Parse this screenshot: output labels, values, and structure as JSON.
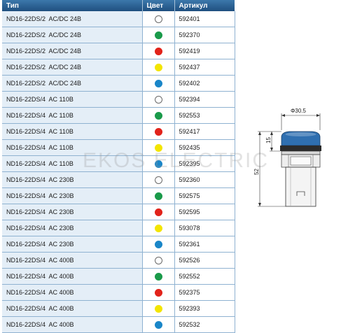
{
  "table": {
    "headers": [
      "Тип",
      "Цвет",
      "Артикул"
    ],
    "rows": [
      {
        "type": "ND16-22DS/2  AC/DC 24B",
        "color": "white",
        "article": "592401"
      },
      {
        "type": "ND16-22DS/2  AC/DC 24B",
        "color": "green",
        "article": "592370"
      },
      {
        "type": "ND16-22DS/2  AC/DC 24B",
        "color": "red",
        "article": "592419"
      },
      {
        "type": "ND16-22DS/2  AC/DC 24B",
        "color": "yellow",
        "article": "592437"
      },
      {
        "type": "ND16-22DS/2  AC/DC 24B",
        "color": "blue",
        "article": "592402"
      },
      {
        "type": "ND16-22DS/4  AC 110B",
        "color": "white",
        "article": "592394"
      },
      {
        "type": "ND16-22DS/4  AC 110B",
        "color": "green",
        "article": "592553"
      },
      {
        "type": "ND16-22DS/4  AC 110B",
        "color": "red",
        "article": "592417"
      },
      {
        "type": "ND16-22DS/4  AC 110B",
        "color": "yellow",
        "article": "592435"
      },
      {
        "type": "ND16-22DS/4  AC 110B",
        "color": "blue",
        "article": "592395"
      },
      {
        "type": "ND16-22DS/4  AC 230B",
        "color": "white",
        "article": "592360"
      },
      {
        "type": "ND16-22DS/4  AC 230B",
        "color": "green",
        "article": "592575"
      },
      {
        "type": "ND16-22DS/4  AC 230B",
        "color": "red",
        "article": "592595"
      },
      {
        "type": "ND16-22DS/4  AC 230B",
        "color": "yellow",
        "article": "593078"
      },
      {
        "type": "ND16-22DS/4  AC 230B",
        "color": "blue",
        "article": "592361"
      },
      {
        "type": "ND16-22DS/4  AC 400B",
        "color": "white",
        "article": "592526"
      },
      {
        "type": "ND16-22DS/4  AC 400B",
        "color": "green",
        "article": "592552"
      },
      {
        "type": "ND16-22DS/4  AC 400B",
        "color": "red",
        "article": "592375"
      },
      {
        "type": "ND16-22DS/4  AC 400B",
        "color": "yellow",
        "article": "592393"
      },
      {
        "type": "ND16-22DS/4  AC 400B",
        "color": "blue",
        "article": "592532"
      }
    ]
  },
  "dot_colors": {
    "white": "#ffffff",
    "green": "#1a9a4a",
    "red": "#e2231a",
    "yellow": "#f3e500",
    "blue": "#1a86c8"
  },
  "drawing": {
    "diameter_label": "Φ30.5",
    "height_label": "15",
    "length_label": "52",
    "lens_color": "#2f6fb0"
  },
  "watermark": "EKOS ELECTRIC"
}
